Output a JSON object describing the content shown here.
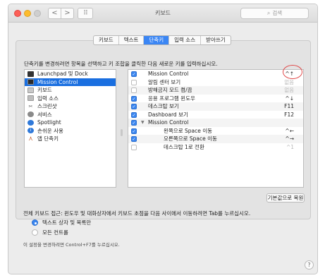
{
  "window": {
    "title": "키보드"
  },
  "toolbar": {
    "back_glyph": "<",
    "forward_glyph": ">",
    "grid_glyph": "⠿",
    "search_placeholder": "검색",
    "search_icon": "search-icon"
  },
  "tabs": [
    {
      "label": "키보드",
      "active": false
    },
    {
      "label": "텍스트",
      "active": false
    },
    {
      "label": "단축키",
      "active": true
    },
    {
      "label": "입력 소스",
      "active": false
    },
    {
      "label": "받아쓰기",
      "active": false
    }
  ],
  "instruction": "단축키를 변경하려면 항목을 선택하고 키 조합을 클릭한 다음 새로운 키를 입력하십시오.",
  "categories": [
    {
      "label": "Launchpad 및 Dock",
      "icon": "launchpad-icon"
    },
    {
      "label": "Mission Control",
      "icon": "mission-control-icon",
      "selected": true
    },
    {
      "label": "키보드",
      "icon": "keyboard-icon"
    },
    {
      "label": "입력 소스",
      "icon": "input-source-icon"
    },
    {
      "label": "스크린샷",
      "icon": "screenshot-icon"
    },
    {
      "label": "서비스",
      "icon": "services-icon"
    },
    {
      "label": "Spotlight",
      "icon": "spotlight-icon"
    },
    {
      "label": "손쉬운 사용",
      "icon": "accessibility-icon"
    },
    {
      "label": "앱 단축키",
      "icon": "app-shortcuts-icon"
    }
  ],
  "shortcuts": [
    {
      "name": "Mission Control",
      "key": "^↑",
      "checked": true
    },
    {
      "name": "알림 센터 보기",
      "key": "없음",
      "checked": false
    },
    {
      "name": "방해금지 모드 켬/끔",
      "key": "없음",
      "checked": false
    },
    {
      "name": "응용 프로그램 윈도우",
      "key": "^↓",
      "checked": true
    },
    {
      "name": "데스크탑 보기",
      "key": "F11",
      "checked": true
    },
    {
      "name": "Dashboard 보기",
      "key": "F12",
      "checked": true
    },
    {
      "name": "Mission Control",
      "key": "",
      "checked": true,
      "group": true
    },
    {
      "name": "왼쪽으로 Space 이동",
      "key": "^←",
      "checked": true,
      "indent": true
    },
    {
      "name": "오른쪽으로 Space 이동",
      "key": "^→",
      "checked": true,
      "indent": true
    },
    {
      "name": "데스크탑 1로 전환",
      "key": "^1",
      "checked": false,
      "indent": true
    }
  ],
  "restore_button": "기본값으로 복원",
  "full_keyboard_access": {
    "label": "전체 키보드 접근: 윈도우 및 대화상자에서 키보드 초점을 다음 사이에서 이동하려면 Tab를 누르십시오.",
    "options": [
      {
        "label": "텍스트 상자 및 목록만",
        "selected": true
      },
      {
        "label": "모든 컨트롤",
        "selected": false
      }
    ],
    "note": "이 설정을 변경하려면 Control+F7를 누르십시오."
  },
  "help_glyph": "?",
  "colors": {
    "accent": "#3b86f4",
    "selection": "#1a6fe0",
    "annotation": "#e04848"
  }
}
